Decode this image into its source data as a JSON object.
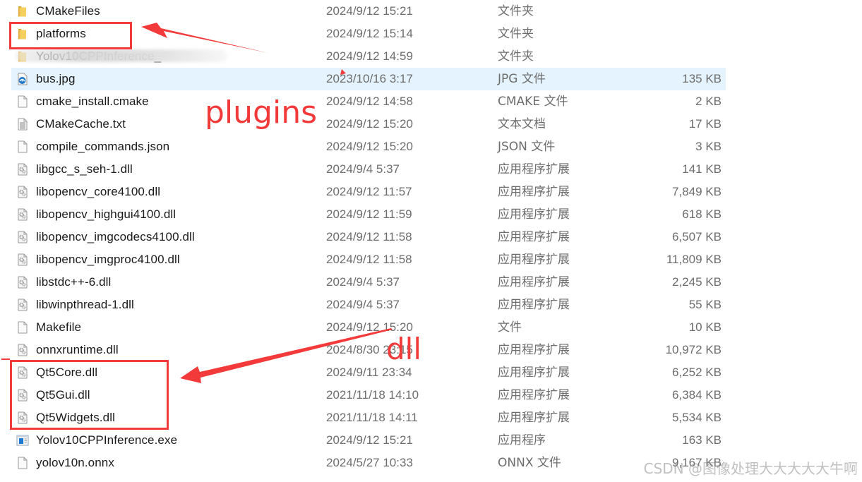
{
  "files": [
    {
      "name": "CMakeFiles",
      "date": "2024/9/12 15:21",
      "type": "文件夹",
      "size": "",
      "icon": "folder-icon"
    },
    {
      "name": "platforms",
      "date": "2024/9/12 15:14",
      "type": "文件夹",
      "size": "",
      "icon": "folder-icon"
    },
    {
      "name": "Yolov10CPPInference_",
      "date": "2024/9/12 14:59",
      "type": "文件夹",
      "size": "",
      "icon": "folder-icon",
      "blurred": true
    },
    {
      "name": "bus.jpg",
      "date": "2023/10/16 3:17",
      "type": "JPG 文件",
      "size": "135 KB",
      "icon": "image-file-icon",
      "selected": true
    },
    {
      "name": "cmake_install.cmake",
      "date": "2024/9/12 14:58",
      "type": "CMAKE 文件",
      "size": "2 KB",
      "icon": "blank-file-icon"
    },
    {
      "name": "CMakeCache.txt",
      "date": "2024/9/12 15:20",
      "type": "文本文档",
      "size": "17 KB",
      "icon": "text-file-icon"
    },
    {
      "name": "compile_commands.json",
      "date": "2024/9/12 15:20",
      "type": "JSON 文件",
      "size": "3 KB",
      "icon": "blank-file-icon"
    },
    {
      "name": "libgcc_s_seh-1.dll",
      "date": "2024/9/4 5:37",
      "type": "应用程序扩展",
      "size": "141 KB",
      "icon": "dll-file-icon"
    },
    {
      "name": "libopencv_core4100.dll",
      "date": "2024/9/12 11:57",
      "type": "应用程序扩展",
      "size": "7,849 KB",
      "icon": "dll-file-icon"
    },
    {
      "name": "libopencv_highgui4100.dll",
      "date": "2024/9/12 11:59",
      "type": "应用程序扩展",
      "size": "618 KB",
      "icon": "dll-file-icon"
    },
    {
      "name": "libopencv_imgcodecs4100.dll",
      "date": "2024/9/12 11:58",
      "type": "应用程序扩展",
      "size": "6,507 KB",
      "icon": "dll-file-icon"
    },
    {
      "name": "libopencv_imgproc4100.dll",
      "date": "2024/9/12 11:58",
      "type": "应用程序扩展",
      "size": "11,809 KB",
      "icon": "dll-file-icon"
    },
    {
      "name": "libstdc++-6.dll",
      "date": "2024/9/4 5:37",
      "type": "应用程序扩展",
      "size": "2,245 KB",
      "icon": "dll-file-icon"
    },
    {
      "name": "libwinpthread-1.dll",
      "date": "2024/9/4 5:37",
      "type": "应用程序扩展",
      "size": "55 KB",
      "icon": "dll-file-icon"
    },
    {
      "name": "Makefile",
      "date": "2024/9/12 15:20",
      "type": "文件",
      "size": "10 KB",
      "icon": "blank-file-icon"
    },
    {
      "name": "onnxruntime.dll",
      "date": "2024/8/30 23:15",
      "type": "应用程序扩展",
      "size": "10,972 KB",
      "icon": "dll-file-icon"
    },
    {
      "name": "Qt5Core.dll",
      "date": "2024/9/11 23:34",
      "type": "应用程序扩展",
      "size": "6,252 KB",
      "icon": "dll-file-icon"
    },
    {
      "name": "Qt5Gui.dll",
      "date": "2021/11/18 14:10",
      "type": "应用程序扩展",
      "size": "6,384 KB",
      "icon": "dll-file-icon"
    },
    {
      "name": "Qt5Widgets.dll",
      "date": "2021/11/18 14:11",
      "type": "应用程序扩展",
      "size": "5,534 KB",
      "icon": "dll-file-icon"
    },
    {
      "name": "Yolov10CPPInference.exe",
      "date": "2024/9/12 15:21",
      "type": "应用程序",
      "size": "163 KB",
      "icon": "exe-file-icon"
    },
    {
      "name": "yolov10n.onnx",
      "date": "2024/5/27 10:33",
      "type": "ONNX 文件",
      "size": "9,167 KB",
      "icon": "blank-file-icon"
    }
  ],
  "annotations": {
    "plugins_label": "plugins",
    "dll_label": "dll",
    "color": "#f23a3a"
  },
  "watermark": "CSDN @图像处理大大大大大牛啊",
  "colors": {
    "selected_row": "#e5f3ff",
    "folder": "#f3c64c",
    "text_primary": "#1a1a1a",
    "text_secondary": "#6d6d6d"
  }
}
